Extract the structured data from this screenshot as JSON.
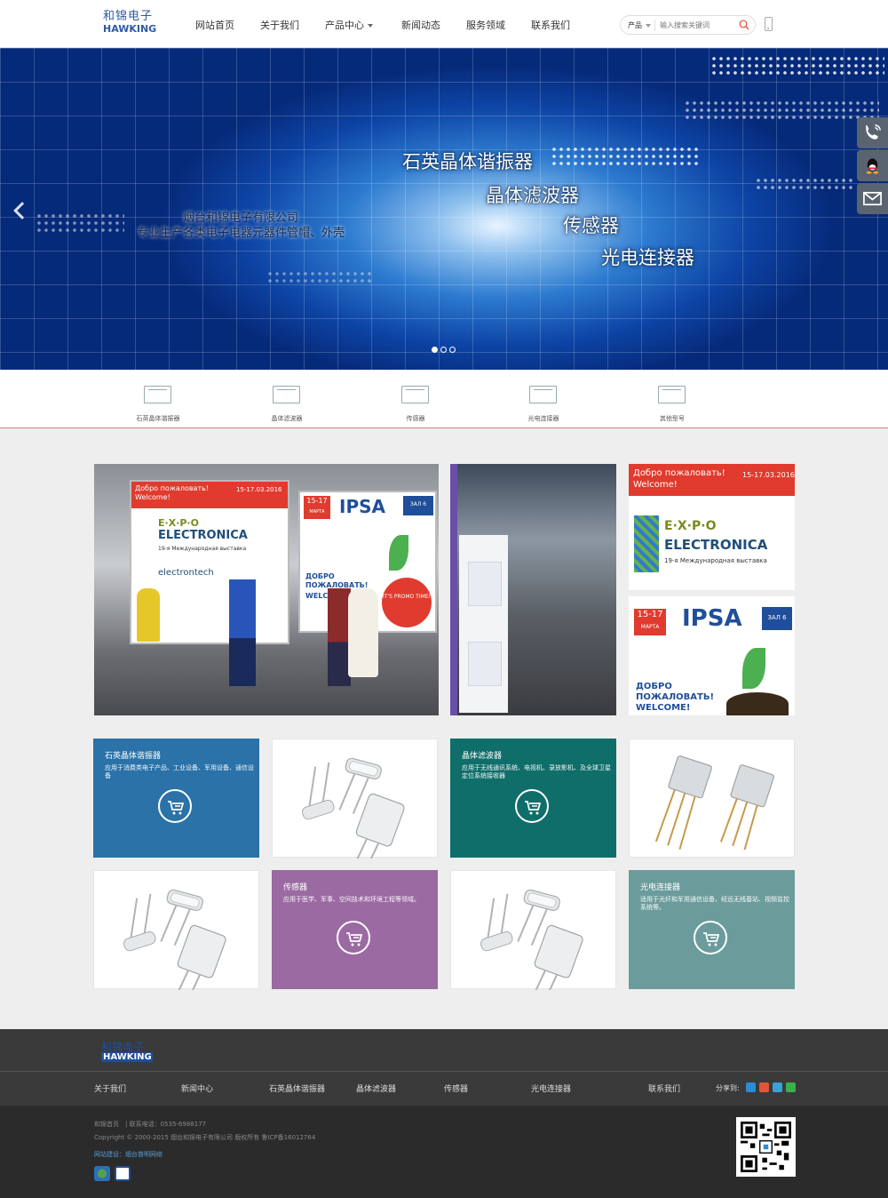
{
  "header": {
    "logo_cn": "和锦电子",
    "logo_en": "HAWKING",
    "nav": [
      "网站首页",
      "关于我们",
      "产品中心",
      "新闻动态",
      "服务领域",
      "联系我们"
    ],
    "search_category": "产品",
    "search_placeholder": "输入搜索关键词"
  },
  "banner": {
    "company": "烟台和锦电子有限公司",
    "slogan": "专业生产各类电子电器元器件管帽、外壳",
    "products": [
      "石英晶体谐振器",
      "晶体滤波器",
      "传感器",
      "光电连接器"
    ],
    "slides": 3,
    "active_slide": 1
  },
  "side_float": [
    "phone-icon",
    "qq-icon",
    "mail-icon"
  ],
  "categories": [
    "石英晶体谐振器",
    "晶体滤波器",
    "传感器",
    "光电连接器",
    "其他型号"
  ],
  "photos": {
    "expo_banner_left": {
      "greeting": "Добро пожаловать!",
      "welcome": "Welcome!",
      "dates": "15-17.03.2016",
      "expo": "E·X·P·O",
      "name": "ELECTRONICA",
      "sub": "19-я Международная выставка",
      "brand": "electrontech"
    },
    "ipsa": {
      "dates": "15-17",
      "month": "МАРТА",
      "name": "IPSA",
      "hall": "ЗАЛ 6",
      "ru": "ДОБРО ПОЖАЛОВАТЬ!",
      "welcome": "WELCOME!",
      "promo": "IT'S PROMO TIME!"
    }
  },
  "products": [
    {
      "title": "石英晶体谐振器",
      "desc": "应用于消费类电子产品、工业设备、军用设备、通信设备",
      "color": "#2a72a8"
    },
    {
      "title": "晶体滤波器",
      "desc": "应用于无线通讯系统、电视机、录放影机、及全球卫星定位系统接收器",
      "color": "#0f6e6a"
    },
    {
      "title": "传感器",
      "desc": "应用于医学、军事、空间技术和环境工程等领域。",
      "color": "#9b6aa2"
    },
    {
      "title": "光电连接器",
      "desc": "适用于光纤和军用通信设备、经远无线基站、视频监控系统等。",
      "color": "#6b9c9b"
    }
  ],
  "footer": {
    "logo_cn": "和锦电子",
    "logo_en": "HAWKING",
    "links": [
      "关于我们",
      "新闻中心",
      "石英晶体谐振器",
      "晶体滤波器",
      "传感器",
      "光电连接器",
      "联系我们"
    ],
    "share_label": "分享到:",
    "line1": "和锦首页　|  联系电话：0535-6988177",
    "copyright": "Copyright © 2000-2015 烟台和锦电子有限公司 版权所有 鲁ICP备16012764",
    "builder_label": "网站建设：",
    "builder_name": "烟台普明网络"
  }
}
